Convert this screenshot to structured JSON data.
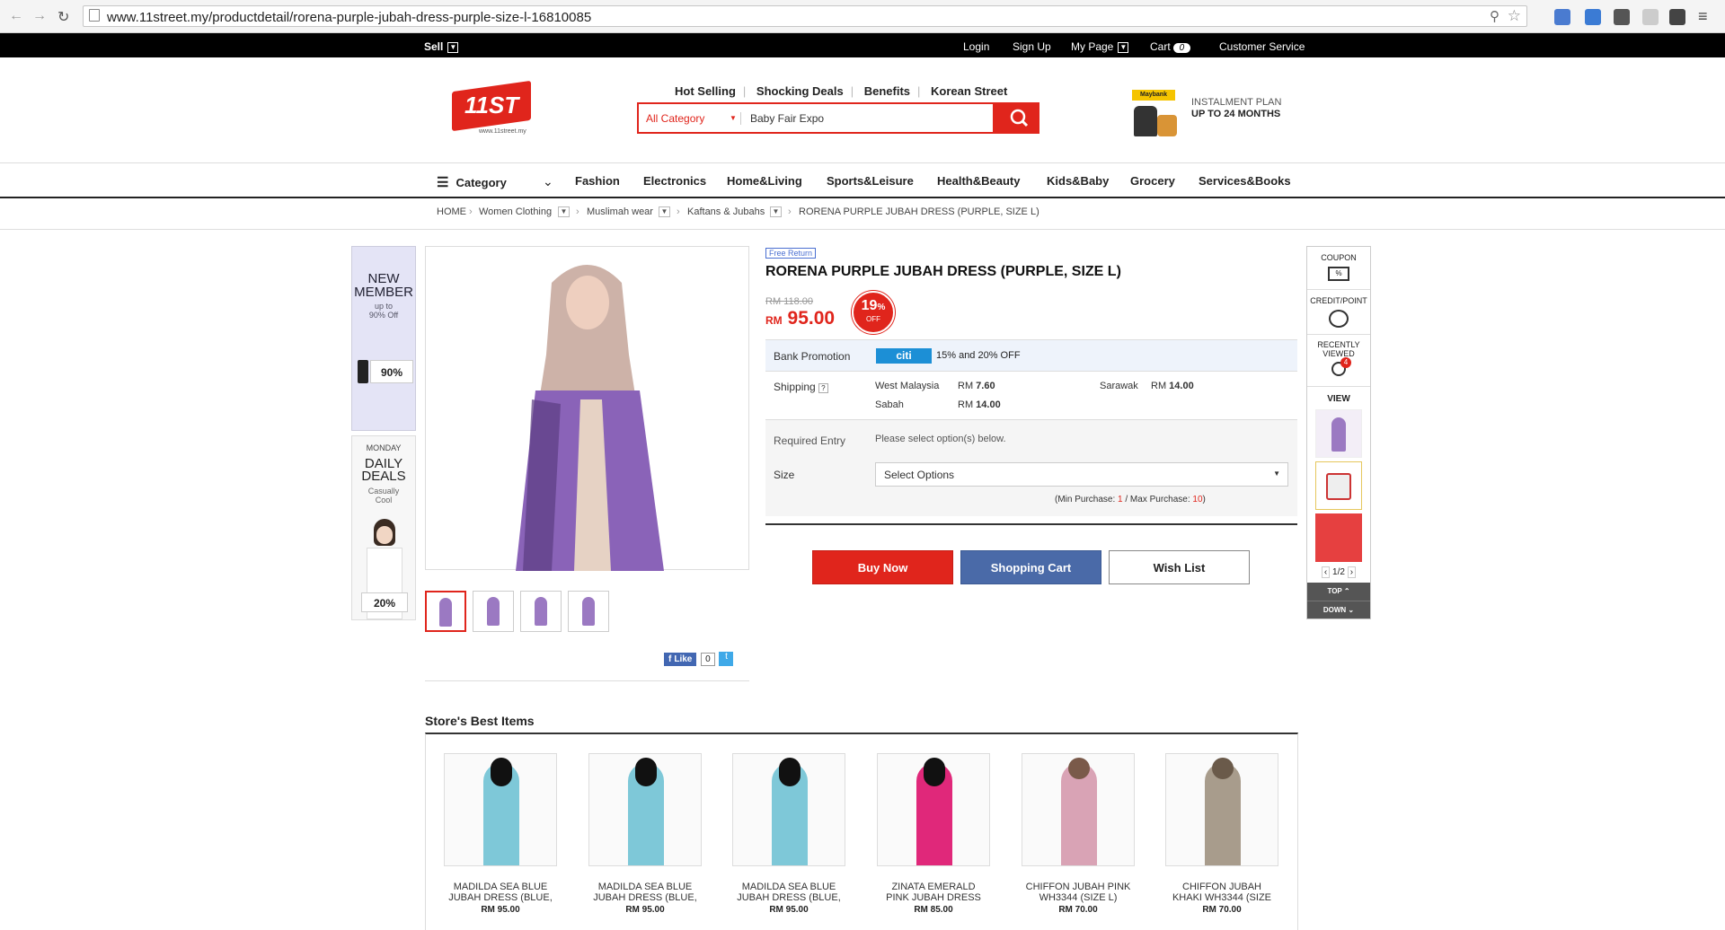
{
  "browser": {
    "url": "www.11street.my/productdetail/rorena-purple-jubah-dress-purple-size-l-16810085"
  },
  "topbar": {
    "sell": "Sell",
    "login": "Login",
    "signup": "Sign Up",
    "mypage": "My Page",
    "cart": "Cart",
    "cart_count": "0",
    "customer_service": "Customer Service"
  },
  "header": {
    "logo_text": "11ST",
    "logo_sub": "www.11street.my",
    "links": [
      "Hot Selling",
      "Shocking Deals",
      "Benefits",
      "Korean Street"
    ],
    "search_category": "All Category",
    "search_value": "Baby Fair Expo",
    "promo_brand": "Maybank",
    "promo_line1": "INSTALMENT PLAN",
    "promo_line2": "UP TO 24 MONTHS"
  },
  "catnav": {
    "category": "Category",
    "items": [
      "Fashion",
      "Electronics",
      "Home&Living",
      "Sports&Leisure",
      "Health&Beauty",
      "Kids&Baby",
      "Grocery",
      "Services&Books"
    ]
  },
  "breadcrumb": [
    "HOME",
    "Women Clothing",
    "Muslimah wear",
    "Kaftans & Jubahs",
    "RORENA PURPLE JUBAH DRESS (PURPLE, SIZE L)"
  ],
  "leftads": {
    "ad1": {
      "line1": "NEW",
      "line2": "MEMBER",
      "line3": "up to",
      "line4": "90% Off",
      "badge": "90%"
    },
    "ad2": {
      "line1": "MONDAY",
      "line2": "DAILY",
      "line3": "DEALS",
      "line4": "Casually",
      "line5": "Cool",
      "badge": "20%"
    }
  },
  "product": {
    "free_return": "Free Return",
    "title": "RORENA PURPLE JUBAH DRESS (PURPLE, SIZE L)",
    "old_price": "RM 118.00",
    "currency": "RM",
    "price": "95.00",
    "discount": "19",
    "discount_unit": "%",
    "discount_off": "OFF",
    "bank_label": "Bank Promotion",
    "bank_name": "citi",
    "bank_text": "15% and 20% OFF",
    "shipping_label": "Shipping",
    "shipping_help": "?",
    "shipping": [
      {
        "region": "West Malaysia",
        "rm": "RM",
        "price": "7.60"
      },
      {
        "region": "Sarawak",
        "rm": "RM",
        "price": "14.00"
      },
      {
        "region": "Sabah",
        "rm": "RM",
        "price": "14.00"
      }
    ],
    "required_label": "Required Entry",
    "required_text": "Please select option(s) below.",
    "size_label": "Size",
    "size_select": "Select Options",
    "min_label": "(Min Purchase: ",
    "min_value": "1",
    "max_label": " / Max Purchase: ",
    "max_value": "10",
    "close_paren": ")",
    "buy_now": "Buy Now",
    "shopping_cart": "Shopping Cart",
    "wish_list": "Wish List",
    "fb_like": "Like",
    "fb_count": "0"
  },
  "rightside": {
    "coupon": "COUPON",
    "credit": "CREDIT/POINT",
    "recent1": "RECENTLY",
    "recent2": "VIEWED",
    "recent_count": "4",
    "view": "VIEW",
    "page": "1/2",
    "top": "TOP",
    "down": "DOWN"
  },
  "best": {
    "title": "Store's Best Items",
    "items": [
      {
        "name1": "MADILDA SEA BLUE",
        "name2": "JUBAH DRESS (BLUE,",
        "price": "RM 95.00",
        "color": "#7ec8d8"
      },
      {
        "name1": "MADILDA SEA BLUE",
        "name2": "JUBAH DRESS (BLUE,",
        "price": "RM 95.00",
        "color": "#7ec8d8"
      },
      {
        "name1": "MADILDA SEA BLUE",
        "name2": "JUBAH DRESS (BLUE,",
        "price": "RM 95.00",
        "color": "#7ec8d8"
      },
      {
        "name1": "ZINATA EMERALD",
        "name2": "PINK JUBAH DRESS",
        "price": "RM 85.00",
        "color": "#e0287a"
      },
      {
        "name1": "CHIFFON JUBAH PINK",
        "name2": "WH3344 (SIZE L)",
        "price": "RM 70.00",
        "color": "#d9a3b5"
      },
      {
        "name1": "CHIFFON JUBAH",
        "name2": "KHAKI WH3344 (SIZE",
        "price": "RM 70.00",
        "color": "#a89c8c"
      }
    ]
  },
  "colors": {
    "accent": "#e0251c",
    "cart_btn": "#4a6aa8"
  }
}
